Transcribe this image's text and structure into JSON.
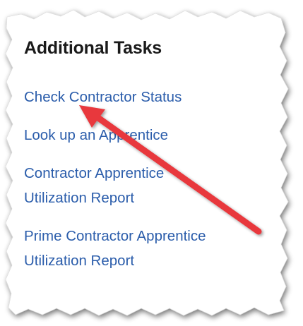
{
  "panel": {
    "title": "Additional Tasks",
    "tasks": [
      {
        "lines": [
          "Check Contractor Status"
        ]
      },
      {
        "lines": [
          "Look up an Apprentice"
        ]
      },
      {
        "lines": [
          "Contractor Apprentice",
          "Utilization Report"
        ]
      },
      {
        "lines": [
          "Prime Contractor Apprentice",
          "Utilization Report"
        ]
      }
    ]
  },
  "colors": {
    "title": "#1a1a1a",
    "link": "#2b5dab",
    "annotation_arrow": "#e8383d"
  },
  "annotation": {
    "icon": "red-arrow-icon",
    "points_to": "Check Contractor Status"
  }
}
